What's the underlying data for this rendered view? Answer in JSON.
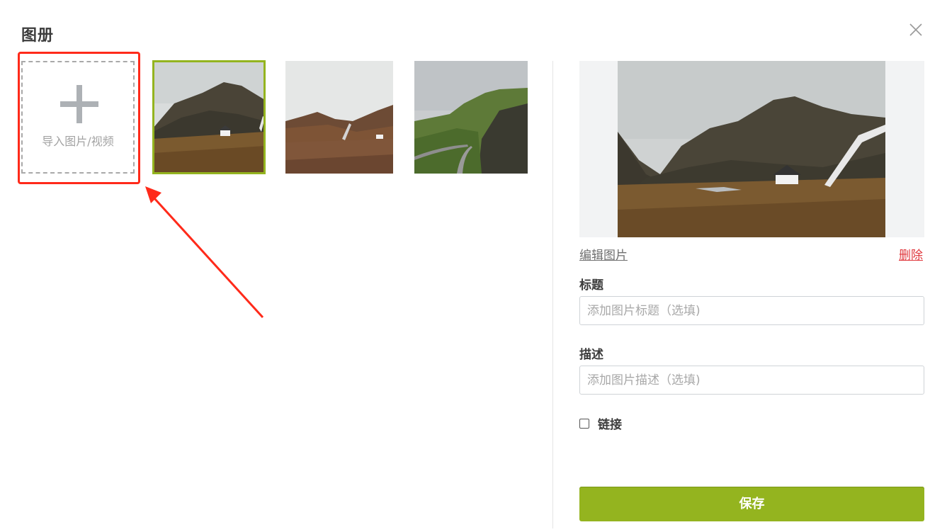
{
  "dialog": {
    "title": "图册",
    "close_icon": "close-icon"
  },
  "gallery": {
    "import_label": "导入图片/视频",
    "import_icon": "plus-icon",
    "thumbnails": [
      {
        "selected": true
      },
      {
        "selected": false
      },
      {
        "selected": false
      }
    ],
    "selected_color": "#94b41f",
    "highlight_color": "#ff2a1a"
  },
  "editor": {
    "edit_link": "编辑图片",
    "delete_link": "删除",
    "title_label": "标题",
    "title_placeholder": "添加图片标题（选填)",
    "desc_label": "描述",
    "desc_placeholder": "添加图片描述（选填)",
    "link_label": "链接",
    "link_checked": false,
    "save_label": "保存",
    "save_color": "#94b41f",
    "delete_color": "#e0393e"
  }
}
